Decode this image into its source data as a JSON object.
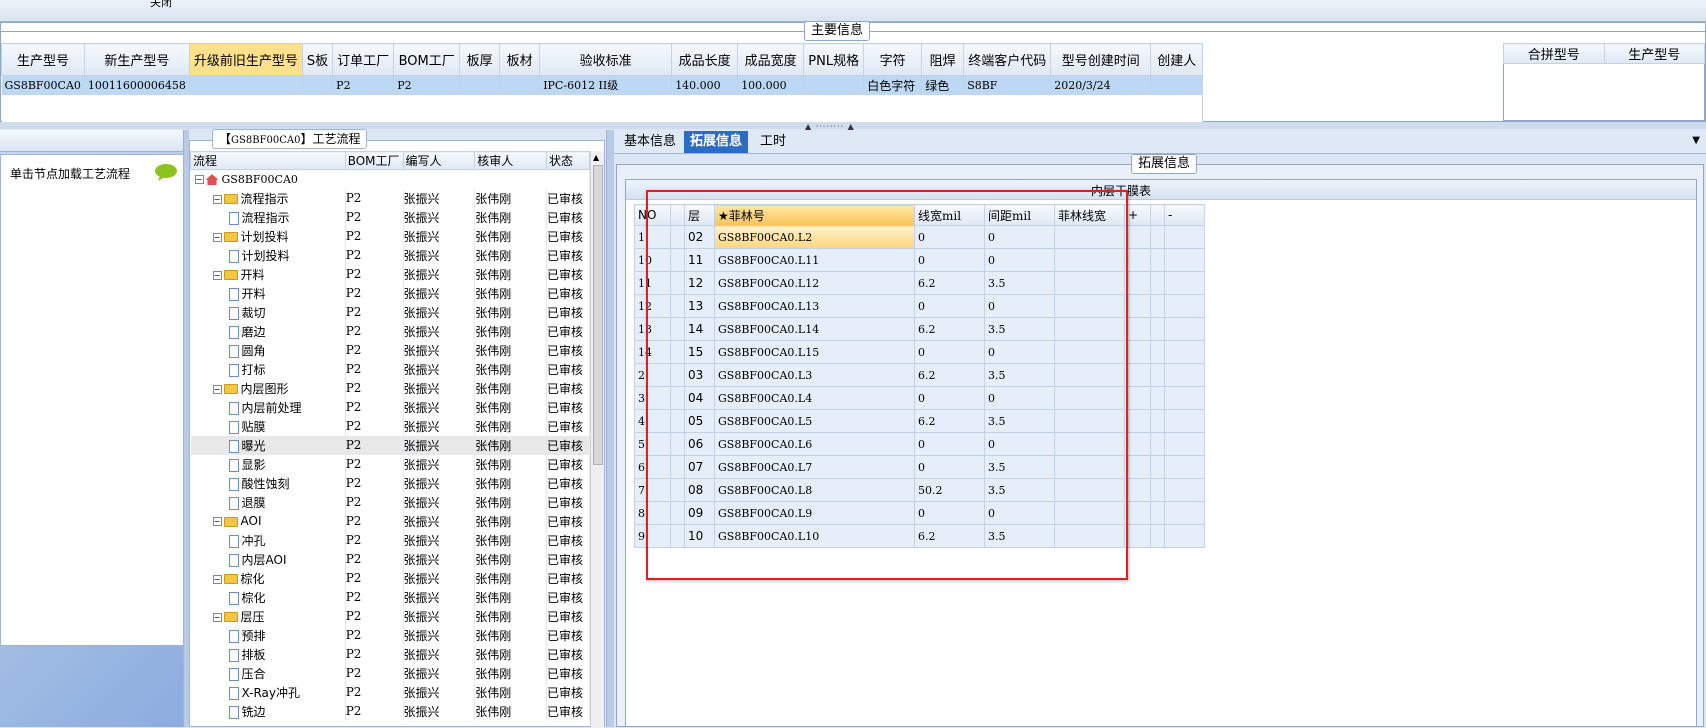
{
  "top": {
    "title_fragment": "关闭"
  },
  "main_info": {
    "legend": "主要信息",
    "columns": [
      "生产型号",
      "新生产型号",
      "升级前旧生产型号",
      "S板",
      "订单工厂",
      "BOM工厂",
      "板厚",
      "板材",
      "验收标准",
      "成品长度",
      "成品宽度",
      "PNL规格",
      "字符",
      "阻焊",
      "终端客户代码",
      "型号创建时间",
      "创建人"
    ],
    "highlight_column": "升级前旧生产型号",
    "row": [
      "GS8BF00CA0",
      "10011600006458",
      "",
      "",
      "P2",
      "P2",
      "",
      "",
      "IPC-6012 II级",
      "140.000",
      "100.000",
      "",
      "白色字符",
      "绿色",
      "S8BF",
      "2020/3/24",
      ""
    ],
    "right_columns": [
      "合拼型号",
      "生产型号"
    ]
  },
  "left_panel": {
    "hint": "单击节点加载工艺流程",
    "bubble_icon": "speech-bubble-icon"
  },
  "flow": {
    "title_prefix": "【",
    "title_code": "GS8BF00CA0",
    "title_suffix": "】工艺流程",
    "headers": [
      "流程",
      "BOM工厂",
      "编写人",
      "核审人",
      "状态"
    ],
    "root": "GS8BF00CA0",
    "rows": [
      {
        "name": "流程指示",
        "type": "folder",
        "level": 1,
        "bom": "P2",
        "writer": "张振兴",
        "reviewer": "张伟刚",
        "status": "已审核"
      },
      {
        "name": "流程指示",
        "type": "doc",
        "level": 2,
        "bom": "P2",
        "writer": "张振兴",
        "reviewer": "张伟刚",
        "status": "已审核"
      },
      {
        "name": "计划投料",
        "type": "folder",
        "level": 1,
        "bom": "P2",
        "writer": "张振兴",
        "reviewer": "张伟刚",
        "status": "已审核"
      },
      {
        "name": "计划投料",
        "type": "doc",
        "level": 2,
        "bom": "P2",
        "writer": "张振兴",
        "reviewer": "张伟刚",
        "status": "已审核"
      },
      {
        "name": "开料",
        "type": "folder",
        "level": 1,
        "bom": "P2",
        "writer": "张振兴",
        "reviewer": "张伟刚",
        "status": "已审核"
      },
      {
        "name": "开料",
        "type": "doc",
        "level": 2,
        "bom": "P2",
        "writer": "张振兴",
        "reviewer": "张伟刚",
        "status": "已审核"
      },
      {
        "name": "裁切",
        "type": "doc",
        "level": 2,
        "bom": "P2",
        "writer": "张振兴",
        "reviewer": "张伟刚",
        "status": "已审核"
      },
      {
        "name": "磨边",
        "type": "doc",
        "level": 2,
        "bom": "P2",
        "writer": "张振兴",
        "reviewer": "张伟刚",
        "status": "已审核"
      },
      {
        "name": "圆角",
        "type": "doc",
        "level": 2,
        "bom": "P2",
        "writer": "张振兴",
        "reviewer": "张伟刚",
        "status": "已审核"
      },
      {
        "name": "打标",
        "type": "doc",
        "level": 2,
        "bom": "P2",
        "writer": "张振兴",
        "reviewer": "张伟刚",
        "status": "已审核"
      },
      {
        "name": "内层图形",
        "type": "folder",
        "level": 1,
        "bom": "P2",
        "writer": "张振兴",
        "reviewer": "张伟刚",
        "status": "已审核"
      },
      {
        "name": "内层前处理",
        "type": "doc",
        "level": 2,
        "bom": "P2",
        "writer": "张振兴",
        "reviewer": "张伟刚",
        "status": "已审核"
      },
      {
        "name": "贴膜",
        "type": "doc",
        "level": 2,
        "bom": "P2",
        "writer": "张振兴",
        "reviewer": "张伟刚",
        "status": "已审核"
      },
      {
        "name": "曝光",
        "type": "doc",
        "level": 2,
        "bom": "P2",
        "writer": "张振兴",
        "reviewer": "张伟刚",
        "status": "已审核",
        "selected": true
      },
      {
        "name": "显影",
        "type": "doc",
        "level": 2,
        "bom": "P2",
        "writer": "张振兴",
        "reviewer": "张伟刚",
        "status": "已审核"
      },
      {
        "name": "酸性蚀刻",
        "type": "doc",
        "level": 2,
        "bom": "P2",
        "writer": "张振兴",
        "reviewer": "张伟刚",
        "status": "已审核"
      },
      {
        "name": "退膜",
        "type": "doc",
        "level": 2,
        "bom": "P2",
        "writer": "张振兴",
        "reviewer": "张伟刚",
        "status": "已审核"
      },
      {
        "name": "AOI",
        "type": "folder",
        "level": 1,
        "bom": "P2",
        "writer": "张振兴",
        "reviewer": "张伟刚",
        "status": "已审核"
      },
      {
        "name": "冲孔",
        "type": "doc",
        "level": 2,
        "bom": "P2",
        "writer": "张振兴",
        "reviewer": "张伟刚",
        "status": "已审核"
      },
      {
        "name": "内层AOI",
        "type": "doc",
        "level": 2,
        "bom": "P2",
        "writer": "张振兴",
        "reviewer": "张伟刚",
        "status": "已审核"
      },
      {
        "name": "棕化",
        "type": "folder",
        "level": 1,
        "bom": "P2",
        "writer": "张振兴",
        "reviewer": "张伟刚",
        "status": "已审核"
      },
      {
        "name": "棕化",
        "type": "doc",
        "level": 2,
        "bom": "P2",
        "writer": "张振兴",
        "reviewer": "张伟刚",
        "status": "已审核"
      },
      {
        "name": "层压",
        "type": "folder",
        "level": 1,
        "bom": "P2",
        "writer": "张振兴",
        "reviewer": "张伟刚",
        "status": "已审核"
      },
      {
        "name": "预排",
        "type": "doc",
        "level": 2,
        "bom": "P2",
        "writer": "张振兴",
        "reviewer": "张伟刚",
        "status": "已审核"
      },
      {
        "name": "排板",
        "type": "doc",
        "level": 2,
        "bom": "P2",
        "writer": "张振兴",
        "reviewer": "张伟刚",
        "status": "已审核"
      },
      {
        "name": "压合",
        "type": "doc",
        "level": 2,
        "bom": "P2",
        "writer": "张振兴",
        "reviewer": "张伟刚",
        "status": "已审核"
      },
      {
        "name": "X-Ray冲孔",
        "type": "doc",
        "level": 2,
        "bom": "P2",
        "writer": "张振兴",
        "reviewer": "张伟刚",
        "status": "已审核"
      },
      {
        "name": "铣边",
        "type": "doc",
        "level": 2,
        "bom": "P2",
        "writer": "张振兴",
        "reviewer": "张伟刚",
        "status": "已审核"
      }
    ]
  },
  "tabs": [
    {
      "label": "基本信息",
      "active": false
    },
    {
      "label": "拓展信息",
      "active": true
    },
    {
      "label": "工时",
      "active": false
    }
  ],
  "ext": {
    "legend": "拓展信息",
    "inner_title": "内层干膜表",
    "headers": [
      "NO",
      "",
      "层",
      "★菲林号",
      "线宽mil",
      "间距mil",
      "菲林线宽",
      "+",
      "",
      "-"
    ],
    "rows": [
      [
        "1",
        "02",
        "GS8BF00CA0.L2",
        "0",
        "0"
      ],
      [
        "10",
        "11",
        "GS8BF00CA0.L11",
        "0",
        "0"
      ],
      [
        "11",
        "12",
        "GS8BF00CA0.L12",
        "6.2",
        "3.5"
      ],
      [
        "12",
        "13",
        "GS8BF00CA0.L13",
        "0",
        "0"
      ],
      [
        "13",
        "14",
        "GS8BF00CA0.L14",
        "6.2",
        "3.5"
      ],
      [
        "14",
        "15",
        "GS8BF00CA0.L15",
        "0",
        "0"
      ],
      [
        "2",
        "03",
        "GS8BF00CA0.L3",
        "6.2",
        "3.5"
      ],
      [
        "3",
        "04",
        "GS8BF00CA0.L4",
        "0",
        "0"
      ],
      [
        "4",
        "05",
        "GS8BF00CA0.L5",
        "6.2",
        "3.5"
      ],
      [
        "5",
        "06",
        "GS8BF00CA0.L6",
        "0",
        "0"
      ],
      [
        "6",
        "07",
        "GS8BF00CA0.L7",
        "0",
        "3.5"
      ],
      [
        "7",
        "08",
        "GS8BF00CA0.L8",
        "50.2",
        "3.5"
      ],
      [
        "8",
        "09",
        "GS8BF00CA0.L9",
        "0",
        "0"
      ],
      [
        "9",
        "10",
        "GS8BF00CA0.L10",
        "6.2",
        "3.5"
      ]
    ]
  },
  "colors": {
    "accent": "#2b6cc4",
    "highlight": "#ffe08c",
    "row_selected": "#bcd8f4",
    "annotation": "#e02020"
  }
}
